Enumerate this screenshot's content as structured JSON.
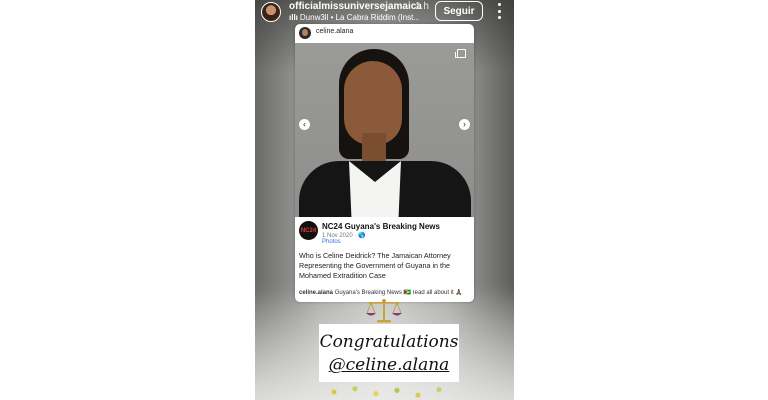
{
  "story": {
    "username": "officialmissuniversejamaica",
    "time": "1 h",
    "music": "Dunw3ll • La Cabra Riddim (Inst...",
    "follow_label": "Seguir"
  },
  "embedded_post": {
    "username": "celine.alana",
    "page_logo_text": "NC24",
    "page_name": "NC24 Guyana's Breaking News",
    "date": "1 Nov 2020 · 🌎",
    "photos_label": "Photos",
    "post_text": "Who is Celine Deidrick? The Jamaican Attorney Representing the Government of Guyana in the Mohamed Extradition Case",
    "caption_user": "celine.alana",
    "caption_text": "Guyana's Breaking News 🇬🇾 read all about it 🙏🏾"
  },
  "sticker": {
    "line1": "Congratulations",
    "line2": "@celine.alana"
  },
  "colors": {
    "follow_border": "#ffffff",
    "photos_link": "#3a6fd8",
    "logo_accent": "#e03b3b"
  }
}
